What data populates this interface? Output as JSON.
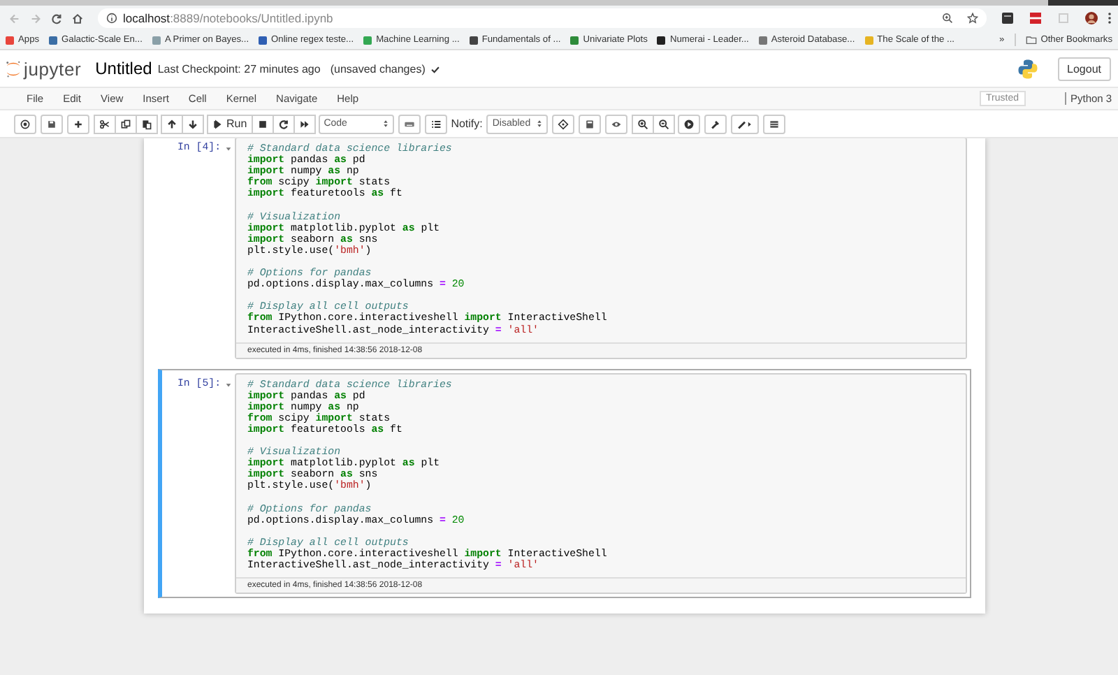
{
  "browser": {
    "url_host": "localhost",
    "url_path": ":8889/notebooks/Untitled.ipynb",
    "bookmarks": [
      {
        "label": "Apps"
      },
      {
        "label": "Galactic-Scale En..."
      },
      {
        "label": "A Primer on Bayes..."
      },
      {
        "label": "Online regex teste..."
      },
      {
        "label": "Machine Learning ..."
      },
      {
        "label": "Fundamentals of ..."
      },
      {
        "label": "Univariate Plots"
      },
      {
        "label": "Numerai - Leader..."
      },
      {
        "label": "Asteroid Database..."
      },
      {
        "label": "The Scale of the ..."
      }
    ],
    "overflow": "»",
    "other_bookmarks": "Other Bookmarks"
  },
  "header": {
    "logo_text": "jupyter",
    "title": "Untitled",
    "checkpoint": "Last Checkpoint: 27 minutes ago",
    "unsaved": "(unsaved changes)",
    "logout": "Logout"
  },
  "menu": {
    "items": [
      "File",
      "Edit",
      "View",
      "Insert",
      "Cell",
      "Kernel",
      "Navigate",
      "Help"
    ],
    "trusted": "Trusted",
    "kernel": "Python 3"
  },
  "toolbar": {
    "run": "Run",
    "cell_type": "Code",
    "notify_label": "Notify:",
    "notify_value": "Disabled"
  },
  "cells": [
    {
      "prompt": "In [4]:",
      "selected": false,
      "info": "executed in 4ms, finished 14:38:56 2018-12-08",
      "blocks": [
        [
          [
            {
              "kind": "comment",
              "text": "# Standard data science libraries"
            }
          ],
          [
            {
              "kind": "keyword",
              "text": "import"
            },
            {
              "kind": "plain",
              "text": " pandas "
            },
            {
              "kind": "keyword",
              "text": "as"
            },
            {
              "kind": "plain",
              "text": " pd"
            }
          ],
          [
            {
              "kind": "keyword",
              "text": "import"
            },
            {
              "kind": "plain",
              "text": " numpy "
            },
            {
              "kind": "keyword",
              "text": "as"
            },
            {
              "kind": "plain",
              "text": " np"
            }
          ],
          [
            {
              "kind": "keyword",
              "text": "from"
            },
            {
              "kind": "plain",
              "text": " scipy "
            },
            {
              "kind": "keyword",
              "text": "import"
            },
            {
              "kind": "plain",
              "text": " stats"
            }
          ],
          [
            {
              "kind": "keyword",
              "text": "import"
            },
            {
              "kind": "plain",
              "text": " featuretools "
            },
            {
              "kind": "keyword",
              "text": "as"
            },
            {
              "kind": "plain",
              "text": " ft"
            }
          ]
        ],
        [
          [
            {
              "kind": "comment",
              "text": "# Visualization"
            }
          ],
          [
            {
              "kind": "keyword",
              "text": "import"
            },
            {
              "kind": "plain",
              "text": " matplotlib.pyplot "
            },
            {
              "kind": "keyword",
              "text": "as"
            },
            {
              "kind": "plain",
              "text": " plt"
            }
          ],
          [
            {
              "kind": "keyword",
              "text": "import"
            },
            {
              "kind": "plain",
              "text": " seaborn "
            },
            {
              "kind": "keyword",
              "text": "as"
            },
            {
              "kind": "plain",
              "text": " sns"
            }
          ],
          [
            {
              "kind": "plain",
              "text": "plt.style.use("
            },
            {
              "kind": "string",
              "text": "'bmh'"
            },
            {
              "kind": "plain",
              "text": ")"
            }
          ]
        ],
        [
          [
            {
              "kind": "comment",
              "text": "# Options for pandas"
            }
          ],
          [
            {
              "kind": "plain",
              "text": "pd.options.display.max_columns "
            },
            {
              "kind": "operator",
              "text": "="
            },
            {
              "kind": "number",
              "text": " 20"
            }
          ]
        ],
        [
          [
            {
              "kind": "comment",
              "text": "# Display all cell outputs"
            }
          ],
          [
            {
              "kind": "keyword",
              "text": "from"
            },
            {
              "kind": "plain",
              "text": " IPython.core.interactiveshell "
            },
            {
              "kind": "keyword",
              "text": "import"
            },
            {
              "kind": "plain",
              "text": " InteractiveShell"
            }
          ],
          [
            {
              "kind": "plain",
              "text": "InteractiveShell.ast_node_interactivity "
            },
            {
              "kind": "operator",
              "text": "="
            },
            {
              "kind": "string",
              "text": " 'all'"
            }
          ]
        ]
      ]
    },
    {
      "prompt": "In [5]:",
      "selected": true,
      "info": "executed in 4ms, finished 14:38:56 2018-12-08",
      "blocks": [
        [
          [
            {
              "kind": "comment",
              "text": "# Standard data science libraries"
            }
          ],
          [
            {
              "kind": "keyword",
              "text": "import"
            },
            {
              "kind": "plain",
              "text": " pandas "
            },
            {
              "kind": "keyword",
              "text": "as"
            },
            {
              "kind": "plain",
              "text": " pd"
            }
          ],
          [
            {
              "kind": "keyword",
              "text": "import"
            },
            {
              "kind": "plain",
              "text": " numpy "
            },
            {
              "kind": "keyword",
              "text": "as"
            },
            {
              "kind": "plain",
              "text": " np"
            }
          ],
          [
            {
              "kind": "keyword",
              "text": "from"
            },
            {
              "kind": "plain",
              "text": " scipy "
            },
            {
              "kind": "keyword",
              "text": "import"
            },
            {
              "kind": "plain",
              "text": " stats"
            }
          ],
          [
            {
              "kind": "keyword",
              "text": "import"
            },
            {
              "kind": "plain",
              "text": " featuretools "
            },
            {
              "kind": "keyword",
              "text": "as"
            },
            {
              "kind": "plain",
              "text": " ft"
            }
          ]
        ],
        [
          [
            {
              "kind": "comment",
              "text": "# Visualization"
            }
          ],
          [
            {
              "kind": "keyword",
              "text": "import"
            },
            {
              "kind": "plain",
              "text": " matplotlib.pyplot "
            },
            {
              "kind": "keyword",
              "text": "as"
            },
            {
              "kind": "plain",
              "text": " plt"
            }
          ],
          [
            {
              "kind": "keyword",
              "text": "import"
            },
            {
              "kind": "plain",
              "text": " seaborn "
            },
            {
              "kind": "keyword",
              "text": "as"
            },
            {
              "kind": "plain",
              "text": " sns"
            }
          ],
          [
            {
              "kind": "plain",
              "text": "plt.style.use("
            },
            {
              "kind": "string",
              "text": "'bmh'"
            },
            {
              "kind": "plain",
              "text": ")"
            }
          ]
        ],
        [
          [
            {
              "kind": "comment",
              "text": "# Options for pandas"
            }
          ],
          [
            {
              "kind": "plain",
              "text": "pd.options.display.max_columns "
            },
            {
              "kind": "operator",
              "text": "="
            },
            {
              "kind": "number",
              "text": " 20"
            }
          ]
        ],
        [
          [
            {
              "kind": "comment",
              "text": "# Display all cell outputs"
            }
          ],
          [
            {
              "kind": "keyword",
              "text": "from"
            },
            {
              "kind": "plain",
              "text": " IPython.core.interactiveshell "
            },
            {
              "kind": "keyword",
              "text": "import"
            },
            {
              "kind": "plain",
              "text": " InteractiveShell"
            }
          ],
          [
            {
              "kind": "plain",
              "text": "InteractiveShell.ast_node_interactivity "
            },
            {
              "kind": "operator",
              "text": "="
            },
            {
              "kind": "string",
              "text": " 'all'"
            }
          ]
        ]
      ]
    }
  ]
}
